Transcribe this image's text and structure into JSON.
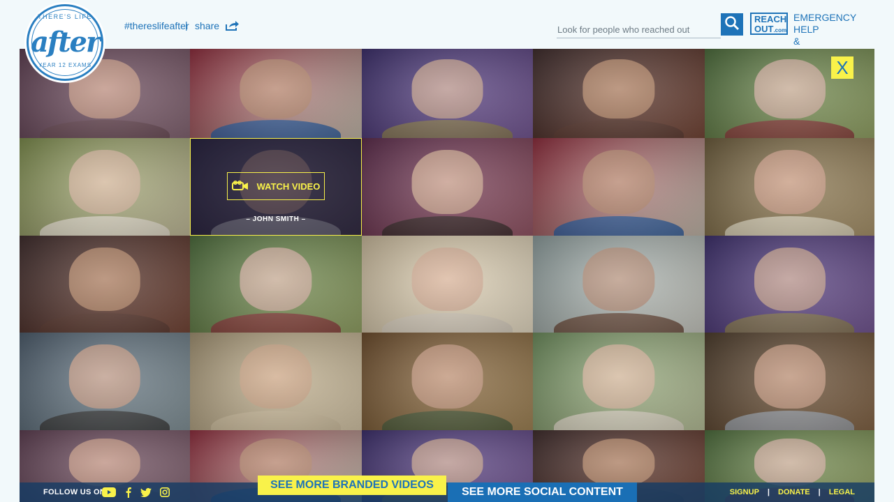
{
  "header": {
    "logo": {
      "top_text": "THERE'S LIFE",
      "word": "after",
      "bottom_text": "YEAR 12 EXAMS"
    },
    "hashtag": "#thereslifeafter",
    "divider": "|",
    "share_label": "share",
    "search": {
      "placeholder": "Look for people who reached out",
      "value": ""
    },
    "reachout": {
      "line1": "REACH",
      "line2": "OUT",
      "suffix": ".com"
    },
    "emergency_line1": "EMERGENCY HELP",
    "emergency_line2": "& INFORMATION"
  },
  "close_label": "X",
  "grid": {
    "hover": {
      "button_label": "WATCH VIDEO",
      "name": "– JOHN SMITH –",
      "icon": "video-camera-icon"
    }
  },
  "footer": {
    "follow_label": "FOLLOW US ON",
    "social_icons": [
      "youtube-icon",
      "facebook-icon",
      "twitter-icon",
      "instagram-icon"
    ],
    "branded_label": "SEE MORE BRANDED VIDEOS",
    "social_label": "SEE MORE SOCIAL CONTENT",
    "links": [
      "SIGNUP",
      "DONATE",
      "LEGAL"
    ],
    "link_separator": "|"
  },
  "colors": {
    "brand_blue": "#1e73b8",
    "accent_yellow": "#f9f24a",
    "background": "#f2f9fb"
  }
}
